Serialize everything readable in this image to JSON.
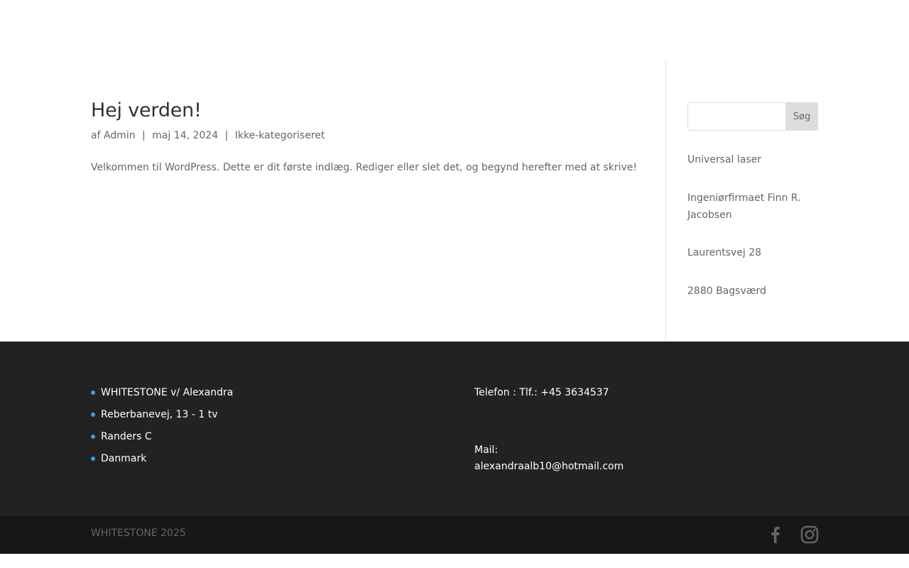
{
  "post": {
    "title": "Hej verden!",
    "meta_prefix": "af",
    "author": "Admin",
    "separator": "|",
    "date": "maj 14, 2024",
    "category": "Ikke-kategoriseret",
    "body": "Velkommen til WordPress. Dette er dit første indlæg. Rediger eller slet det, og begynd herefter med at skrive!"
  },
  "sidebar": {
    "search": {
      "value": "",
      "button_label": "Søg"
    },
    "lines": [
      "Universal laser",
      "Ingeniørfirmaet Finn R. Jacobsen",
      "Laurentsvej 28",
      "2880 Bagsværd"
    ]
  },
  "footer": {
    "address": [
      "WHITESTONE v/ Alexandra",
      "Reberbanevej, 13 - 1 tv",
      "Randers C",
      "Danmark"
    ],
    "phone": "Telefon : Tlf.: +45 3634537",
    "mail_label": "Mail:",
    "mail": "alexandraalb10@hotmail.com",
    "bullet_color": "#2ea3f2",
    "copyright": "WHITESTONE 2025",
    "social": [
      "facebook-icon",
      "instagram-icon"
    ]
  },
  "colors": {
    "footer_bg": "#222222",
    "footer_bottom_bg": "#171717",
    "accent": "#2ea3f2"
  }
}
